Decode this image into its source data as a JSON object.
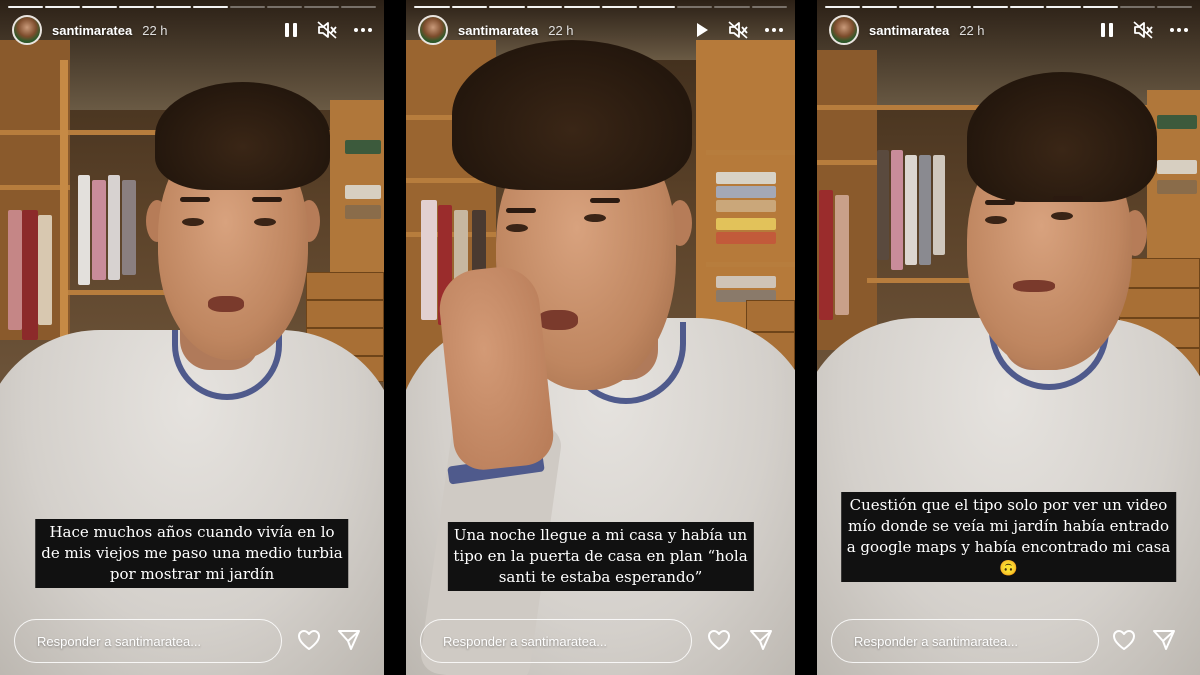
{
  "stories": [
    {
      "id": "story-1",
      "username": "santimaratea",
      "time": "22 h",
      "playback_icon": "pause-icon",
      "caption_lines": [
        "Hace muchos años cuando vivía en lo",
        "de mis viejos me paso una medio turbia",
        "por mostrar mi jardín"
      ],
      "reply_placeholder": "Responder a santimaratea..."
    },
    {
      "id": "story-2",
      "username": "santimaratea",
      "time": "22 h",
      "playback_icon": "play-icon",
      "caption_lines": [
        "Una noche llegue a mi casa y había un",
        "tipo en la puerta de casa  en plan “hola",
        "santi te estaba esperando”"
      ],
      "reply_placeholder": "Responder a santimaratea..."
    },
    {
      "id": "story-3",
      "username": "santimaratea",
      "time": "22 h",
      "playback_icon": "pause-icon",
      "caption_lines": [
        "Cuestión que el tipo solo por ver un video",
        "mío donde se veía mi jardín había entrado",
        "a google maps y había encontrado mi casa",
        "🙃"
      ],
      "reply_placeholder": "Responder a santimaratea..."
    }
  ],
  "icons": {
    "mute": "speaker-muted-icon",
    "more": "more-options-icon",
    "like": "heart-icon",
    "share": "send-icon"
  },
  "colors": {
    "caption_bg": "#111111",
    "sweater": "#d4d0cb",
    "collar": "#4f5a8c",
    "closet_wood": "#b77d3d"
  }
}
